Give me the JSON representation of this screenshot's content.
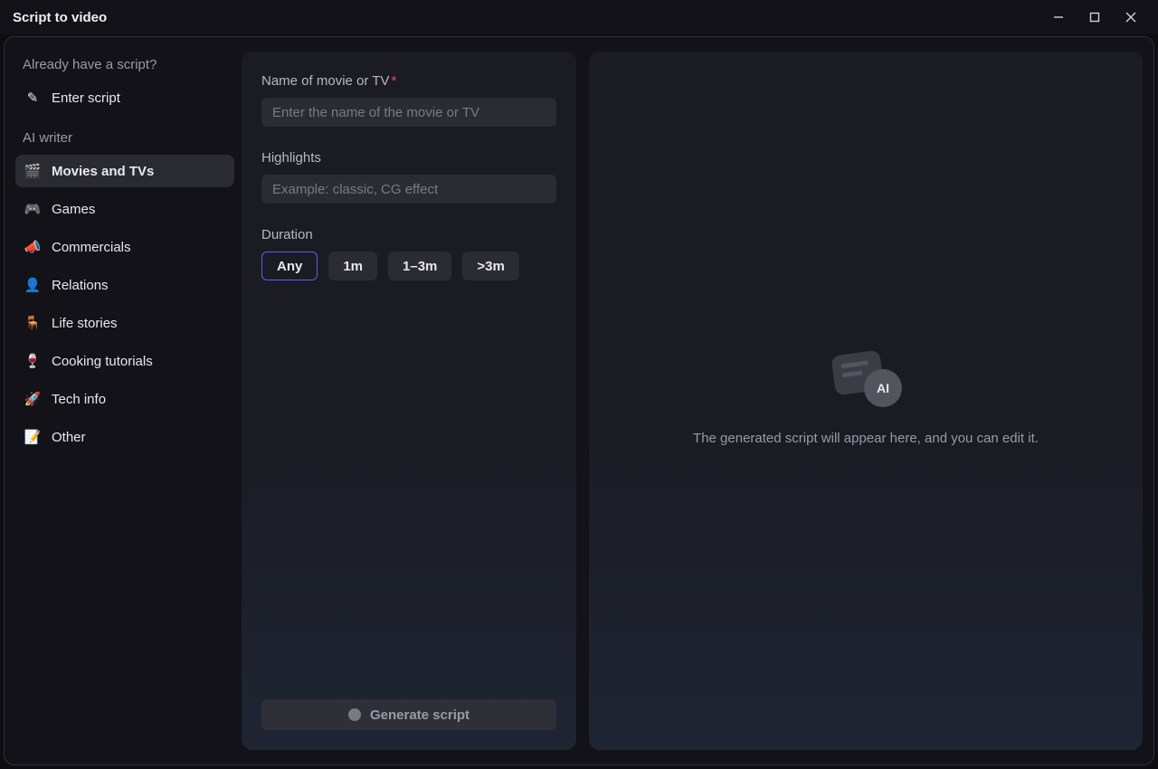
{
  "window": {
    "title": "Script to video"
  },
  "sidebar": {
    "section1_heading": "Already have a script?",
    "enter_script": {
      "label": "Enter script",
      "icon": "✎"
    },
    "section2_heading": "AI writer",
    "items": [
      {
        "id": "movies",
        "label": "Movies and TVs",
        "icon": "🎬",
        "active": true
      },
      {
        "id": "games",
        "label": "Games",
        "icon": "🎮",
        "active": false
      },
      {
        "id": "commercials",
        "label": "Commercials",
        "icon": "📣",
        "active": false
      },
      {
        "id": "relations",
        "label": "Relations",
        "icon": "👤",
        "active": false
      },
      {
        "id": "life",
        "label": "Life stories",
        "icon": "🪑",
        "active": false
      },
      {
        "id": "cooking",
        "label": "Cooking tutorials",
        "icon": "🍷",
        "active": false
      },
      {
        "id": "tech",
        "label": "Tech info",
        "icon": "🚀",
        "active": false
      },
      {
        "id": "other",
        "label": "Other",
        "icon": "📝",
        "active": false
      }
    ]
  },
  "form": {
    "name_label": "Name of movie or TV",
    "name_placeholder": "Enter the name of the movie or TV",
    "name_value": "",
    "highlights_label": "Highlights",
    "highlights_placeholder": "Example: classic, CG effect",
    "highlights_value": "",
    "duration_label": "Duration",
    "duration_options": [
      "Any",
      "1m",
      "1–3m",
      ">3m"
    ],
    "duration_selected": "Any",
    "generate_label": "Generate script"
  },
  "output": {
    "empty_text": "The generated script will appear here, and you can edit it.",
    "ai_badge": "AI"
  }
}
